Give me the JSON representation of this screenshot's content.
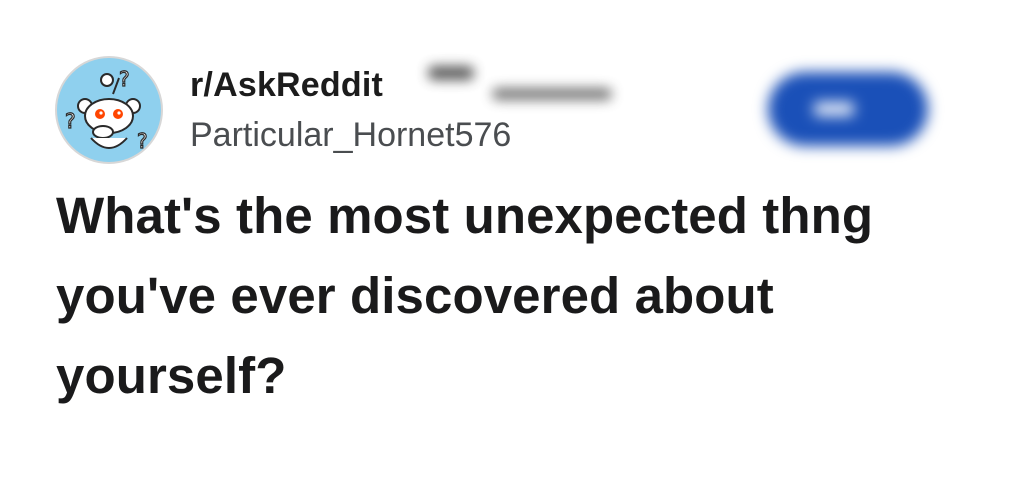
{
  "post": {
    "subreddit": "r/AskReddit",
    "author": "Particular_Hornet576",
    "title": "What's the most unexpected thng you've ever discovered about yourself?"
  },
  "icons": {
    "avatar": "askreddit-snoo-icon"
  },
  "colors": {
    "avatar_background": "#8fd0ee",
    "join_button": "#1a50b8",
    "title_text": "#1a1a1b",
    "author_text": "#4a4d50"
  }
}
